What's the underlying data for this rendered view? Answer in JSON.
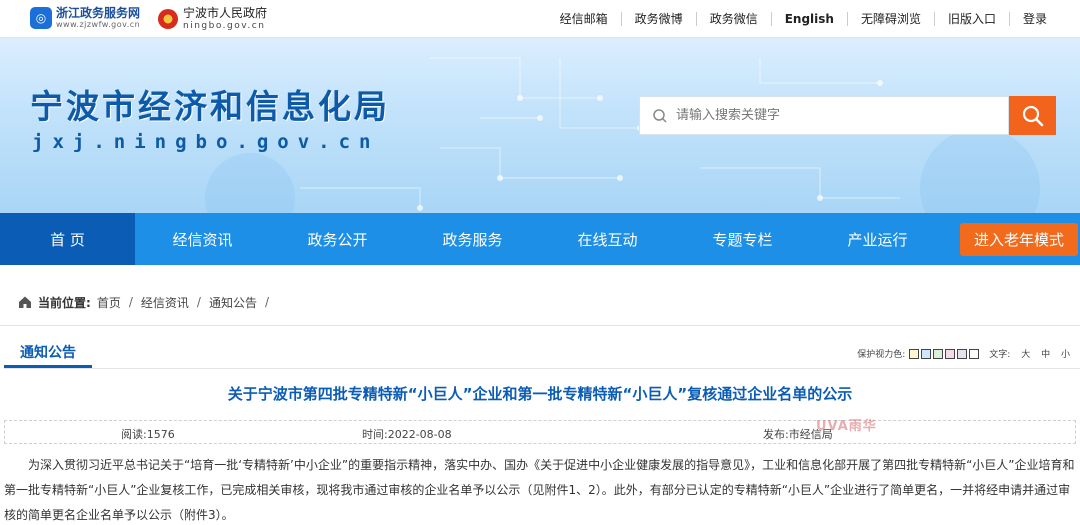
{
  "topbar": {
    "logo1": {
      "name": "浙江政务服务网",
      "url": "www.zjzwfw.gov.cn"
    },
    "logo2": {
      "name": "宁波市人民政府",
      "url": "ningbo.gov.cn"
    },
    "links": [
      "经信邮箱",
      "政务微博",
      "政务微信",
      "English",
      "无障碍浏览",
      "旧版入口",
      "登录"
    ]
  },
  "banner": {
    "title": "宁波市经济和信息化局",
    "domain": "jxj.ningbo.gov.cn",
    "search_placeholder": "请输入搜索关键字"
  },
  "nav": {
    "items": [
      "首 页",
      "经信资讯",
      "政务公开",
      "政务服务",
      "在线互动",
      "专题专栏",
      "产业运行"
    ],
    "elder_mode": "进入老年模式"
  },
  "breadcrumb": {
    "label": "当前位置:",
    "items": [
      "首页",
      "经信资讯",
      "通知公告"
    ]
  },
  "section": {
    "tab": "通知公告",
    "protect_label": "保护视力色:",
    "swatches": [
      "#fff7d0",
      "#cce8ff",
      "#d9f0d9",
      "#f5d9e6",
      "#e6e0f2",
      "#ffffff"
    ],
    "font_label": "文字:",
    "font_sizes": [
      "大",
      "中",
      "小"
    ]
  },
  "article": {
    "title": "关于宁波市第四批专精特新“小巨人”企业和第一批专精特新“小巨人”复核通过企业名单的公示",
    "views": "阅读:1576",
    "time": "时间:2022-08-08",
    "publisher": "发布:市经信局",
    "watermark": "UVA雨华",
    "body": "为深入贯彻习近平总书记关于“培育一批‘专精特新’中小企业”的重要指示精神，落实中办、国办《关于促进中小企业健康发展的指导意见》，工业和信息化部开展了第四批专精特新“小巨人”企业培育和第一批专精特新“小巨人”企业复核工作，已完成相关审核，现将我市通过审核的企业名单予以公示（见附件1、2）。此外，有部分已认定的专精特新“小巨人”企业进行了简单更名，一并将经申请并通过审核的简单更名企业名单予以公示（附件3）。"
  }
}
